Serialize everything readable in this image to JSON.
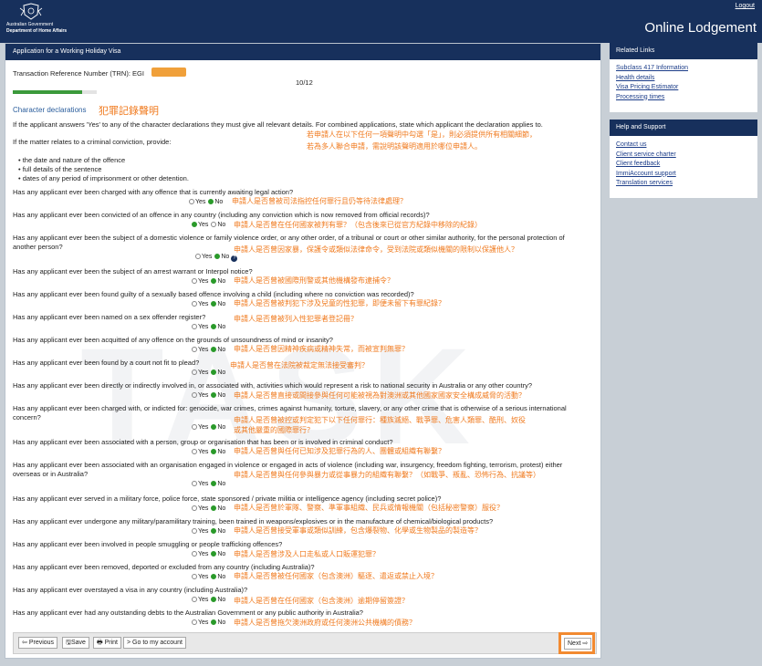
{
  "header": {
    "gov_line1": "Australian Government",
    "gov_line2": "Department of Home Affairs",
    "logout": "Logout",
    "app_title": "Online Lodgement"
  },
  "main": {
    "title": "Application for a Working Holiday Visa",
    "trn_label": "Transaction Reference Number (TRN): EGI",
    "page_indicator": "10/12",
    "progress": 0.83,
    "section_title": "Character declarations",
    "section_annotation": "犯罪記錄聲明",
    "intro": "If the applicant answers 'Yes' to any of the character declarations they must give all relevant details. For combined applications, state which applicant the declaration applies to.",
    "intro_ann1": "若申請人在以下任何一項聲明中勾選「是」，則必須提供所有相關細節，",
    "intro_ann2": "若為多人聯合申請，需說明該聲明適用於哪位申請人。",
    "matter_text": "If the matter relates to a criminal conviction, provide:",
    "bullets": [
      "the date and nature of the offence",
      "full details of the sentence",
      "dates of any period of imprisonment or other detention."
    ],
    "yes_label": "Yes",
    "no_label": "No",
    "questions": [
      {
        "text": "Has any applicant ever been charged with any offence that is currently awaiting legal action?",
        "ann": "申請人是否曾被司法指控任何罪行且仍等待法律處理？"
      },
      {
        "text": "Has any applicant ever been convicted of an offence in any country (including any conviction which is now removed from official records)?",
        "ann": "申請人是否曾在任何國家被判有罪？（包含後來已從官方紀錄中移除的紀錄）"
      },
      {
        "text": "Has any applicant ever been the subject of a domestic violence or family violence order, or any other order, of a tribunal or court or other similar authority, for the personal protection of another person?",
        "ann": "申請人是否曾因家暴，保護令或類似法律命令，受到法院或類似機關的限制以保護他人？"
      },
      {
        "text": "Has any applicant ever been the subject of an arrest warrant or Interpol notice?",
        "ann": "申請人是否曾被國際刑警或其他機構發布逮捕令？"
      },
      {
        "text": "Has any applicant ever been found guilty of a sexually based offence involving a child (including where no conviction was recorded)?",
        "ann": "申請人是否曾被判犯下涉及兒童的性犯罪，即便未留下有罪紀錄？"
      },
      {
        "text": "Has any applicant ever been named on a sex offender register?",
        "ann": "申請人是否曾被列入性犯罪者登記冊？"
      },
      {
        "text": "Has any applicant ever been acquitted of any offence on the grounds of unsoundness of mind or insanity?",
        "ann": "申請人是否曾因精神疾病或精神失常，而被宣判無罪？"
      },
      {
        "text": "Has any applicant ever been found by a court not fit to plead?",
        "ann": "申請人是否曾在法院被裁定無法接受審判？"
      },
      {
        "text": "Has any applicant ever been directly or indirectly involved in, or associated with, activities which would represent a risk to national security in Australia or any other country?",
        "ann": "申請人是否曾直接或間接參與任何可能被視為對澳洲或其他國家國家安全構成威脅的活動？"
      },
      {
        "text": "Has any applicant ever been charged with, or indicted for: genocide, war crimes, crimes against humanity, torture, slavery, or any other crime that is otherwise of a serious international concern?",
        "ann": "申請人是否曾被控或判定犯下以下任何罪行：種族滅絕、戰爭罪、危害人類罪、酷刑、奴役",
        "ann2": "或其他嚴重的國際罪行？"
      },
      {
        "text": "Has any applicant ever been associated with a person, group or organisation that has been or is involved in criminal conduct?",
        "ann": "申請人是否曾與任何已知涉及犯罪行為的人、團體或組織有聯繫？"
      },
      {
        "text": "Has any applicant ever been associated with an organisation engaged in violence or engaged in acts of violence (including war, insurgency, freedom fighting, terrorism, protest) either overseas or in Australia?",
        "ann": "申請人是否曾與任何參與暴力或從事暴力的組織有聯繫？（如戰爭、叛亂、恐怖行為、抗議等）"
      },
      {
        "text": "Has any applicant ever served in a military force, police force, state sponsored / private militia or intelligence agency (including secret police)?",
        "ann": "申請人是否曾於軍隊、警察、準軍事組織、民兵或情報機關（包括秘密警察）服役？"
      },
      {
        "text": "Has any applicant ever undergone any military/paramilitary training, been trained in weapons/explosives or in the manufacture of chemical/biological products?",
        "ann": "申請人是否曾接受軍事或類似訓練，包含爆裂物、化學或生物製品的製造等？"
      },
      {
        "text": "Has any applicant ever been involved in people smuggling or people trafficking offences?",
        "ann": "申請人是否曾涉及人口走私或人口販運犯罪？"
      },
      {
        "text": "Has any applicant ever been removed, deported or excluded from any country (including Australia)?",
        "ann": "申請人是否曾被任何國家（包含澳洲）驅逐、遣返或禁止入境？"
      },
      {
        "text": "Has any applicant ever overstayed a visa in any country (including Australia)?",
        "ann": "申請人是否曾在任何國家（包含澳洲）逾期停留簽證？"
      },
      {
        "text": "Has any applicant ever had any outstanding debts to the Australian Government or any public authority in Australia?",
        "ann": "申請人是否曾拖欠澳洲政府或任何澳洲公共機構的債務？"
      }
    ],
    "watermark": "TASK",
    "buttons": {
      "previous": "Previous",
      "save": "Save",
      "print": "Print",
      "account": "Go to my account",
      "next": "Next"
    }
  },
  "sidebar": {
    "related_title": "Related Links",
    "related": [
      "Subclass 417 Information",
      "Health details",
      "Visa Pricing Estimator",
      "Processing times"
    ],
    "help_title": "Help and Support",
    "help": [
      "Contact us",
      "Client service charter",
      "Client feedback",
      "ImmiAccount support",
      "Translation services"
    ]
  }
}
